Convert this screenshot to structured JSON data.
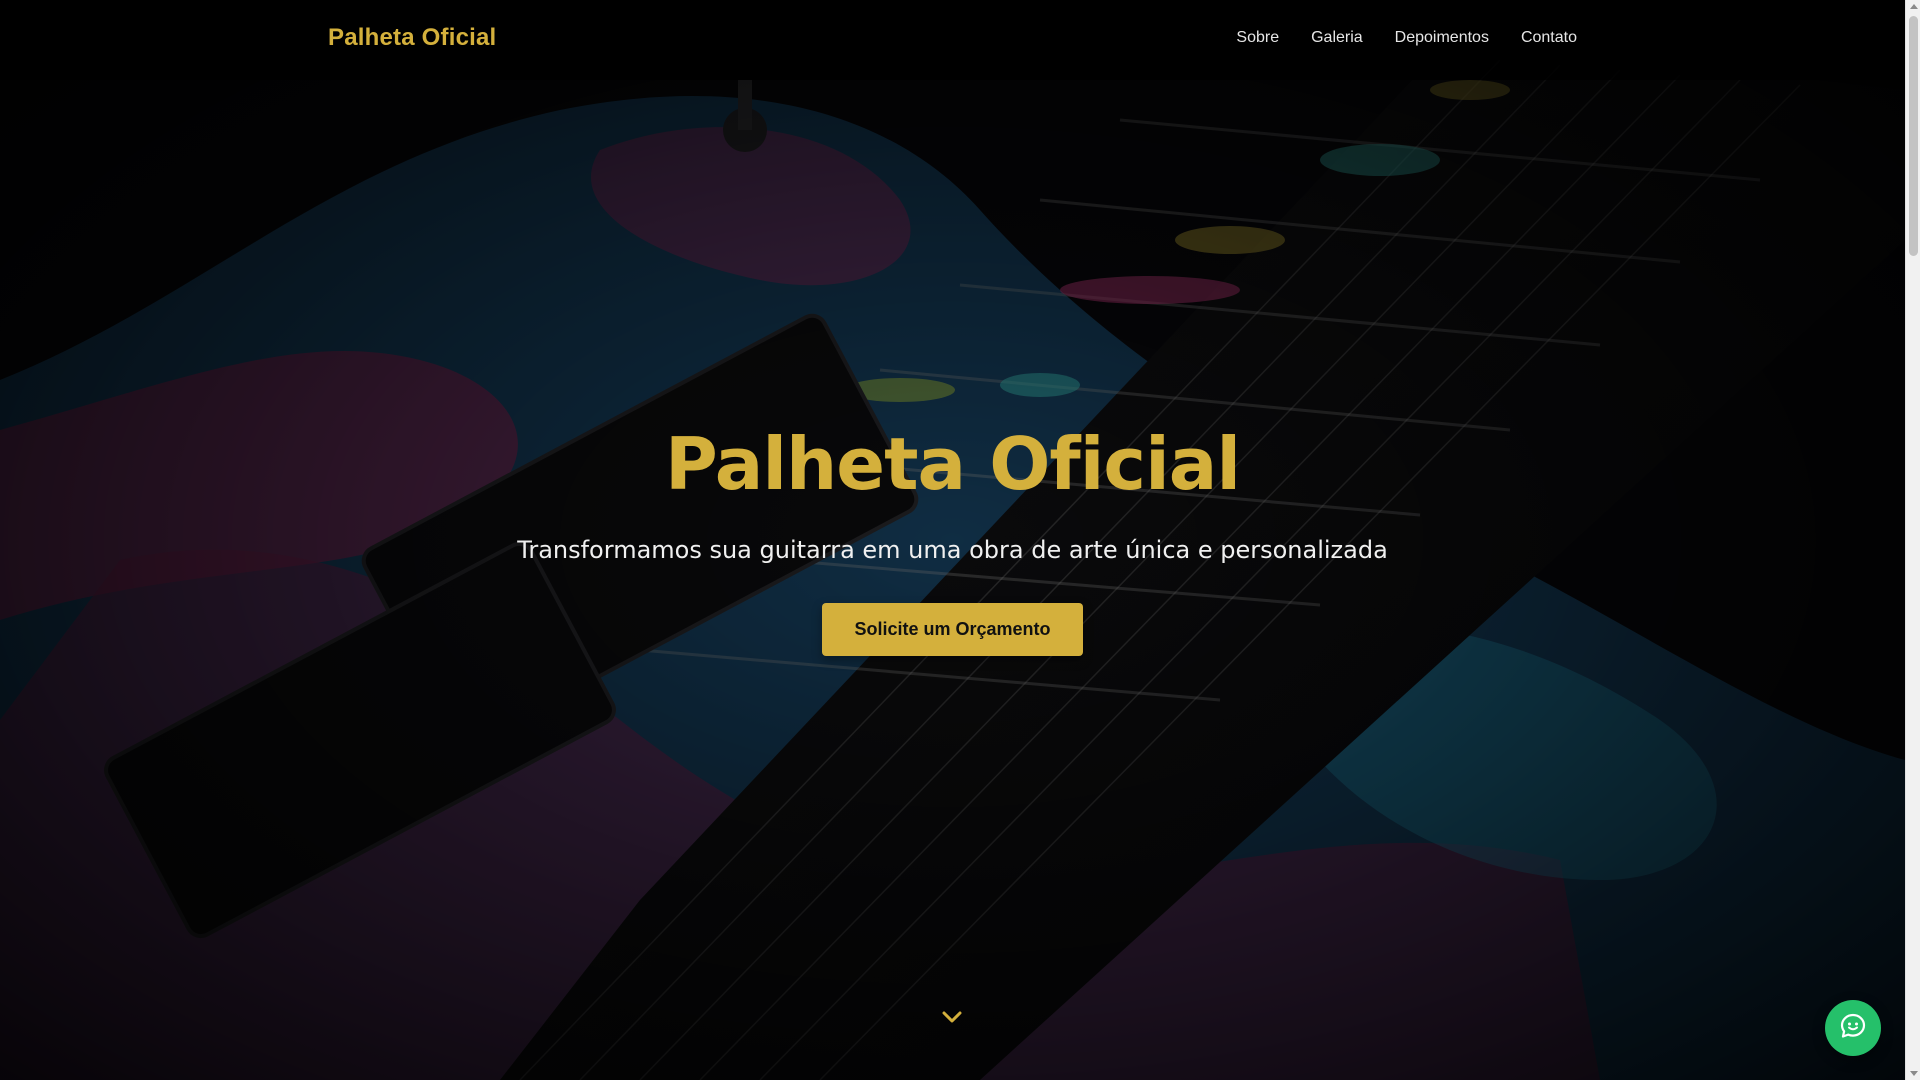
{
  "header": {
    "brand": "Palheta Oficial",
    "nav": [
      {
        "label": "Sobre"
      },
      {
        "label": "Galeria"
      },
      {
        "label": "Depoimentos"
      },
      {
        "label": "Contato"
      }
    ]
  },
  "hero": {
    "title": "Palheta Oficial",
    "subtitle": "Transformamos sua guitarra em uma obra de arte única e personalizada",
    "cta_label": "Solicite um Orçamento",
    "background_image": "custom-painted-guitar-photo",
    "scroll_icon": "chevron-down-icon"
  },
  "chat_button": {
    "icon": "chat-bubble-icon"
  },
  "colors": {
    "accent": "#d4b03c",
    "header_bg": "#000000",
    "chat": "#25c06a",
    "text_light": "#f0f0f0"
  }
}
